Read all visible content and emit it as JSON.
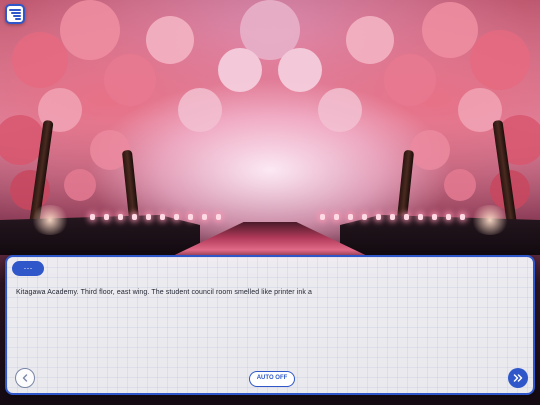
{
  "menu": {
    "icon": "menu-icon"
  },
  "dialogue": {
    "speaker": "···",
    "text": "Kitagawa Academy. Third floor, east wing. The student council room smelled like printer ink a"
  },
  "controls": {
    "back_icon": "chevron-left-icon",
    "auto_label": "AUTO OFF",
    "next_icon": "double-chevron-right-icon"
  },
  "colors": {
    "accent": "#2f57c9",
    "panel": "#fafbff",
    "text": "#1f2330"
  }
}
